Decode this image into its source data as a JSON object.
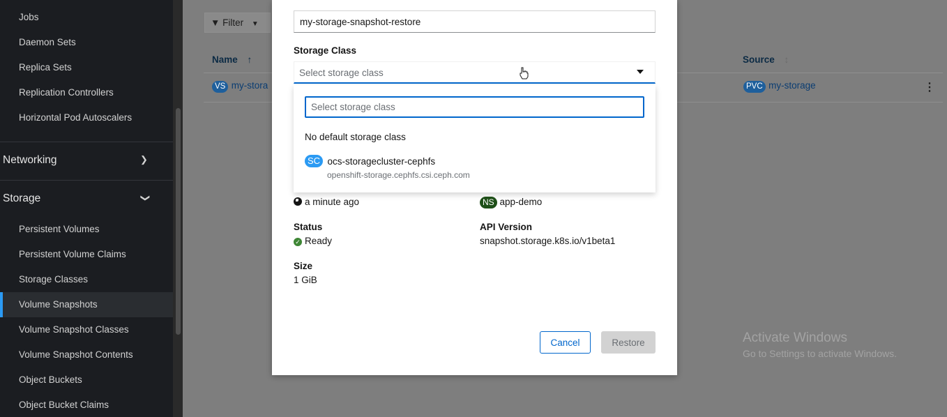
{
  "sidebar": {
    "items_top": [
      "Jobs",
      "Daemon Sets",
      "Replica Sets",
      "Replication Controllers",
      "Horizontal Pod Autoscalers"
    ],
    "networking_label": "Networking",
    "storage_label": "Storage",
    "storage_items": [
      "Persistent Volumes",
      "Persistent Volume Claims",
      "Storage Classes",
      "Volume Snapshots",
      "Volume Snapshot Classes",
      "Volume Snapshot Contents",
      "Object Buckets",
      "Object Bucket Claims"
    ],
    "active_item": "Volume Snapshots"
  },
  "list": {
    "filter_label": "Filter",
    "col_name": "Name",
    "col_source": "Source",
    "row": {
      "name_badge": "VS",
      "name": "my-stora",
      "source_badge": "PVC",
      "source": "my-storage"
    }
  },
  "modal": {
    "name_value": "my-storage-snapshot-restore",
    "storage_class_label": "Storage Class",
    "storage_class_placeholder": "Select storage class",
    "menu": {
      "search_placeholder": "Select storage class",
      "note": "No default storage class",
      "option_badge": "SC",
      "option_title": "ocs-storagecluster-cephfs",
      "option_desc": "openshift-storage.cephfs.csi.ceph.com"
    },
    "created": "a minute ago",
    "namespace_badge": "NS",
    "namespace": "app-demo",
    "status_label": "Status",
    "status_value": "Ready",
    "api_label": "API Version",
    "api_value": "snapshot.storage.k8s.io/v1beta1",
    "size_label": "Size",
    "size_value": "1 GiB",
    "cancel_label": "Cancel",
    "restore_label": "Restore"
  },
  "watermark": {
    "title": "Activate Windows",
    "subtitle": "Go to Settings to activate Windows."
  },
  "colors": {
    "accent": "#0066cc",
    "sidebar_bg": "#1b1d21",
    "sc_badge": "#2b9af3",
    "ready": "#3e8635"
  }
}
